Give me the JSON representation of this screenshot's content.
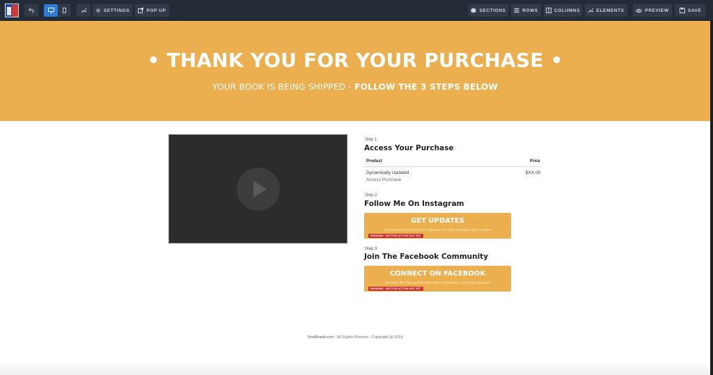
{
  "toolbar": {
    "left": [
      {
        "name": "undo",
        "icon": "undo-icon"
      },
      {
        "name": "desktop-view",
        "icon": "monitor-icon"
      },
      {
        "name": "mobile-view",
        "icon": "mobile-icon"
      },
      {
        "name": "tools",
        "icon": "wrench-icon"
      },
      {
        "name": "settings",
        "icon": "gear-icon",
        "label": "SETTINGS"
      },
      {
        "name": "popup",
        "icon": "external-link-icon",
        "label": "POP UP"
      }
    ],
    "right": [
      {
        "name": "sections",
        "icon": "cube-icon",
        "label": "SECTIONS"
      },
      {
        "name": "rows",
        "icon": "rows-icon",
        "label": "ROWS"
      },
      {
        "name": "columns",
        "icon": "columns-icon",
        "label": "COLUMNS"
      },
      {
        "name": "elements",
        "icon": "wrench-icon",
        "label": "ELEMENTS"
      },
      {
        "name": "preview",
        "icon": "eye-icon",
        "label": "PREVIEW"
      },
      {
        "name": "save",
        "icon": "floppy-icon",
        "label": "SAVE"
      }
    ]
  },
  "hero": {
    "title": "• THANK YOU FOR YOUR PURCHASE •",
    "subtitle_plain": "YOUR BOOK IS BEING SHIPPED - ",
    "subtitle_bold": "FOLLOW THE 3 STEPS BELOW"
  },
  "video": {
    "icon": "play-icon"
  },
  "step1": {
    "label": "Step 1",
    "title": "Access Your Purchase",
    "table": {
      "headers": [
        "Product",
        "Price"
      ],
      "product": "Dynamically Updated",
      "product_sub": "Access Purchase",
      "price": "$XX.00"
    }
  },
  "step2": {
    "label": "Step 2",
    "title": "Follow Me On Instagram",
    "button": "GET UPDATES",
    "button_sub": "and follow Russ Perry for updates on new products and content",
    "warning": "WARNING · BUTTON ACTION NOT SET"
  },
  "step3": {
    "label": "Step 3",
    "title": "Join The Facebook Community",
    "button": "CONNECT ON FACEBOOK",
    "button_sub": "and join the discussion with other members much like yourself",
    "warning": "WARNING · BUTTON ACTION NOT SET"
  },
  "footer": {
    "brand": "YourBrand.com",
    "rest": " - All Rights Reserve - Copyright @ 2014"
  },
  "colors": {
    "toolbar": "#232b36",
    "accent": "#ebaf4f",
    "active": "#2f7bd8",
    "warning": "#c8312a"
  }
}
